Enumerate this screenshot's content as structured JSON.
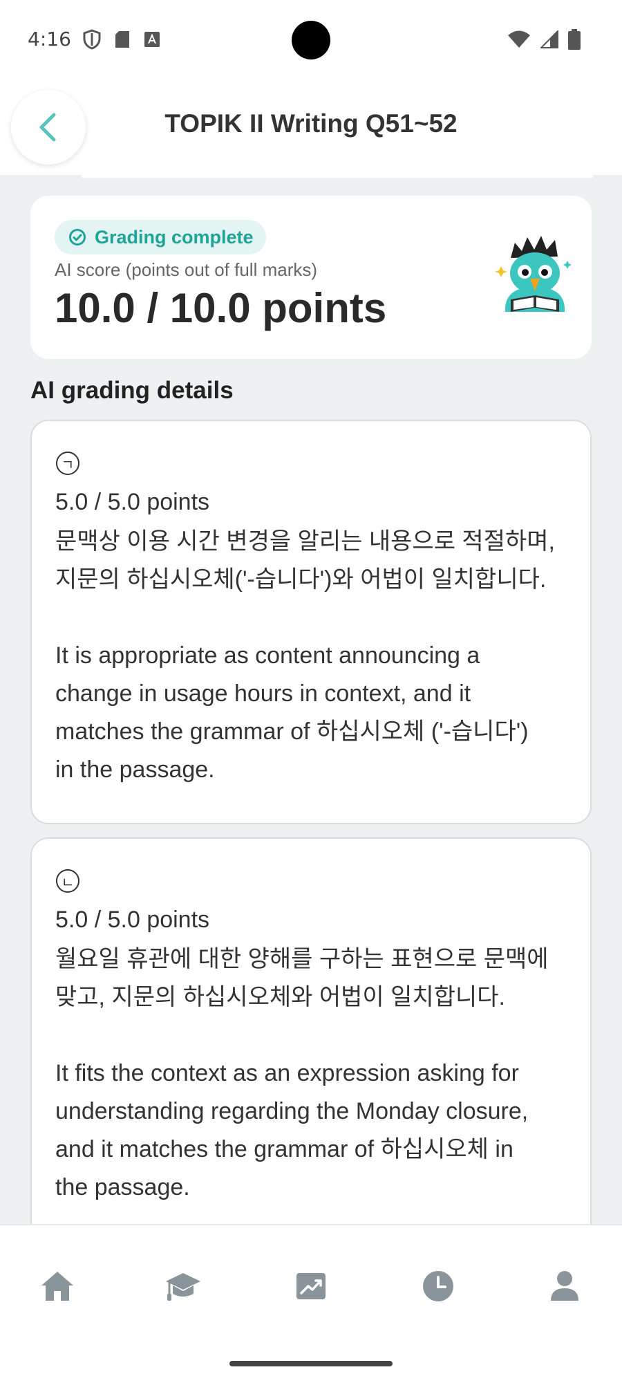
{
  "status_bar": {
    "time": "4:16",
    "left_icons": [
      "shield-icon",
      "sd-card-icon",
      "font-icon"
    ],
    "right_icons": [
      "wifi-icon",
      "signal-icon",
      "battery-icon"
    ]
  },
  "header": {
    "title": "TOPIK II Writing Q51~52",
    "back_icon": "chevron-left-icon"
  },
  "score_card": {
    "badge_label": "Grading complete",
    "caption": "AI score (points out of full marks)",
    "score": "10.0 / 10.0 points"
  },
  "section_title": "AI grading details",
  "details": [
    {
      "marker": "ㄱ",
      "points": "5.0 / 5.0 points",
      "text": "문맥상 이용 시간 변경을 알리는 내용으로 적절하며,\n지문의 하십시오체('-습니다')와 어법이 일치합니다.\n\nIt is appropriate as content announcing a\nchange in usage hours in context, and it\nmatches the grammar of 하십시오체 ('-습니다')\nin the passage."
    },
    {
      "marker": "ㄴ",
      "points": "5.0 / 5.0 points",
      "text": "월요일 휴관에 대한 양해를 구하는 표현으로 문맥에\n맞고, 지문의 하십시오체와 어법이 일치합니다.\n\nIt fits the context as an expression asking for\nunderstanding regarding the Monday closure,\nand it matches the grammar of 하십시오체 in\nthe passage."
    }
  ],
  "bottom_nav": [
    "home-icon",
    "graduation-cap-icon",
    "chart-icon",
    "clock-icon",
    "profile-icon"
  ],
  "colors": {
    "accent": "#1fa597",
    "badge_bg": "#e3f4f2",
    "page_bg": "#eef1f1",
    "nav_icon": "#8a949b"
  }
}
